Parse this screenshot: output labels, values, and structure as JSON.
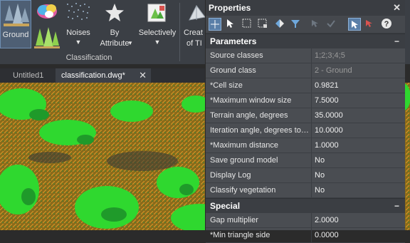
{
  "ribbon": {
    "ground_label": "Ground",
    "noises_label": "Noises",
    "by_attribute_label": "By",
    "by_attribute_label2": "Attribute",
    "selectively_label": "Selectively",
    "create_label": "Creat",
    "create_label2": "of TI",
    "group_label": "Classification"
  },
  "tabs": [
    {
      "label": "Untitled1"
    },
    {
      "label": "classification.dwg*"
    }
  ],
  "properties": {
    "title": "Properties",
    "sections": [
      {
        "title": "Parameters",
        "rows": [
          {
            "name": "Source classes",
            "value": "1;2;3;4;5",
            "dim": true
          },
          {
            "name": "Ground class",
            "value": "2 - Ground",
            "dim": true
          },
          {
            "name": "*Cell size",
            "value": "0.9821"
          },
          {
            "name": "*Maximum window size",
            "value": "7.5000"
          },
          {
            "name": "Terrain angle, degrees",
            "value": "35.0000"
          },
          {
            "name": "Iteration angle, degrees to p...",
            "value": "10.0000"
          },
          {
            "name": "*Maximum distance",
            "value": "1.0000"
          },
          {
            "name": "Save ground model",
            "value": "No"
          },
          {
            "name": "Display Log",
            "value": "No"
          },
          {
            "name": "Classify vegetation",
            "value": "No"
          }
        ]
      },
      {
        "title": "Special",
        "rows": [
          {
            "name": "Gap multiplier",
            "value": "2.0000"
          },
          {
            "name": "*Min triangle side",
            "value": "0.0000"
          }
        ]
      }
    ]
  }
}
